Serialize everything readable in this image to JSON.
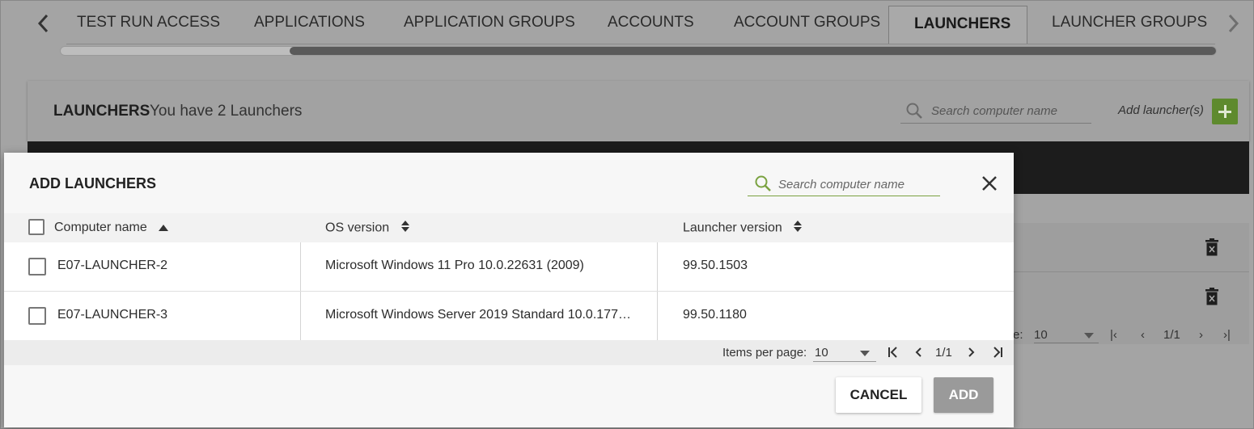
{
  "tabs": {
    "items": [
      {
        "label": "TEST RUN ACCESS"
      },
      {
        "label": "APPLICATIONS"
      },
      {
        "label": "APPLICATION GROUPS"
      },
      {
        "label": "ACCOUNTS"
      },
      {
        "label": "ACCOUNT GROUPS"
      },
      {
        "label": "LAUNCHERS",
        "active": true
      },
      {
        "label": "LAUNCHER GROUPS"
      }
    ],
    "prev_icon": "chevron-left-icon",
    "next_icon": "chevron-right-icon"
  },
  "background_panel": {
    "title": "LAUNCHERS",
    "count_text": "You have 2 Launchers",
    "search_placeholder": "Search computer name",
    "add_label": "Add launcher(s)",
    "add_icon": "plus-icon",
    "row_action_icon": "trash-icon",
    "pager": {
      "items_per_page_partial": "e:",
      "items_per_page_value": "10",
      "page_text": "1/1"
    }
  },
  "modal": {
    "title": "ADD LAUNCHERS",
    "search_placeholder": "Search computer name",
    "close_icon": "close-icon",
    "columns": {
      "computer_name": "Computer name",
      "os_version": "OS version",
      "launcher_version": "Launcher version"
    },
    "rows": [
      {
        "computer_name": "E07-LAUNCHER-2",
        "os_version": "Microsoft Windows 11 Pro 10.0.22631 (2009)",
        "launcher_version": "99.50.1503"
      },
      {
        "computer_name": "E07-LAUNCHER-3",
        "os_version": "Microsoft Windows Server 2019 Standard 10.0.177…",
        "launcher_version": "99.50.1180"
      }
    ],
    "pager": {
      "items_per_page_label": "Items per page:",
      "items_per_page_value": "10",
      "page_text": "1/1"
    },
    "cancel_label": "CANCEL",
    "add_label": "ADD"
  },
  "colors": {
    "accent_green": "#7aa240",
    "add_button_disabled": "#9a9a9a",
    "overlay_gray": "#a4a4a4"
  }
}
